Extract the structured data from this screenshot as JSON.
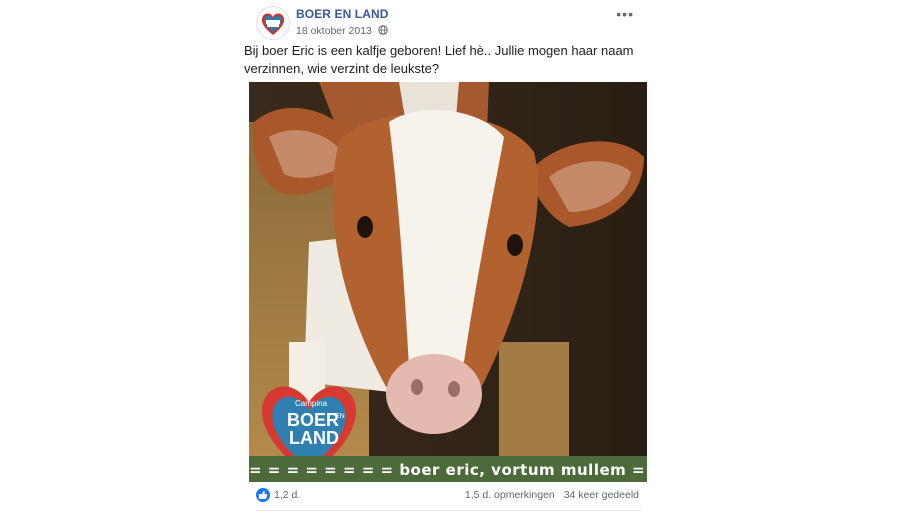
{
  "post": {
    "page_name": "BOER EN LAND",
    "date": "18 oktober 2013",
    "message": "Bij boer Eric is een kalfje geboren! Lief hè.. Jullie mogen haar naam verzinnen, wie verzint de leukste?",
    "more_label": "•••"
  },
  "photo": {
    "logo_line1": "Campina",
    "logo_line2": "BOER",
    "logo_line3": "EN",
    "logo_line4": "LAND",
    "banner": "= = = = = = = =  boer eric, vortum mullem  = ="
  },
  "footer": {
    "likes": "1,2 d.",
    "comments": "1,5 d. opmerkingen",
    "shares": "34 keer gedeeld"
  },
  "colors": {
    "link": "#385898",
    "like_blue": "#1877f2",
    "banner_green": "#4d6a3a"
  }
}
